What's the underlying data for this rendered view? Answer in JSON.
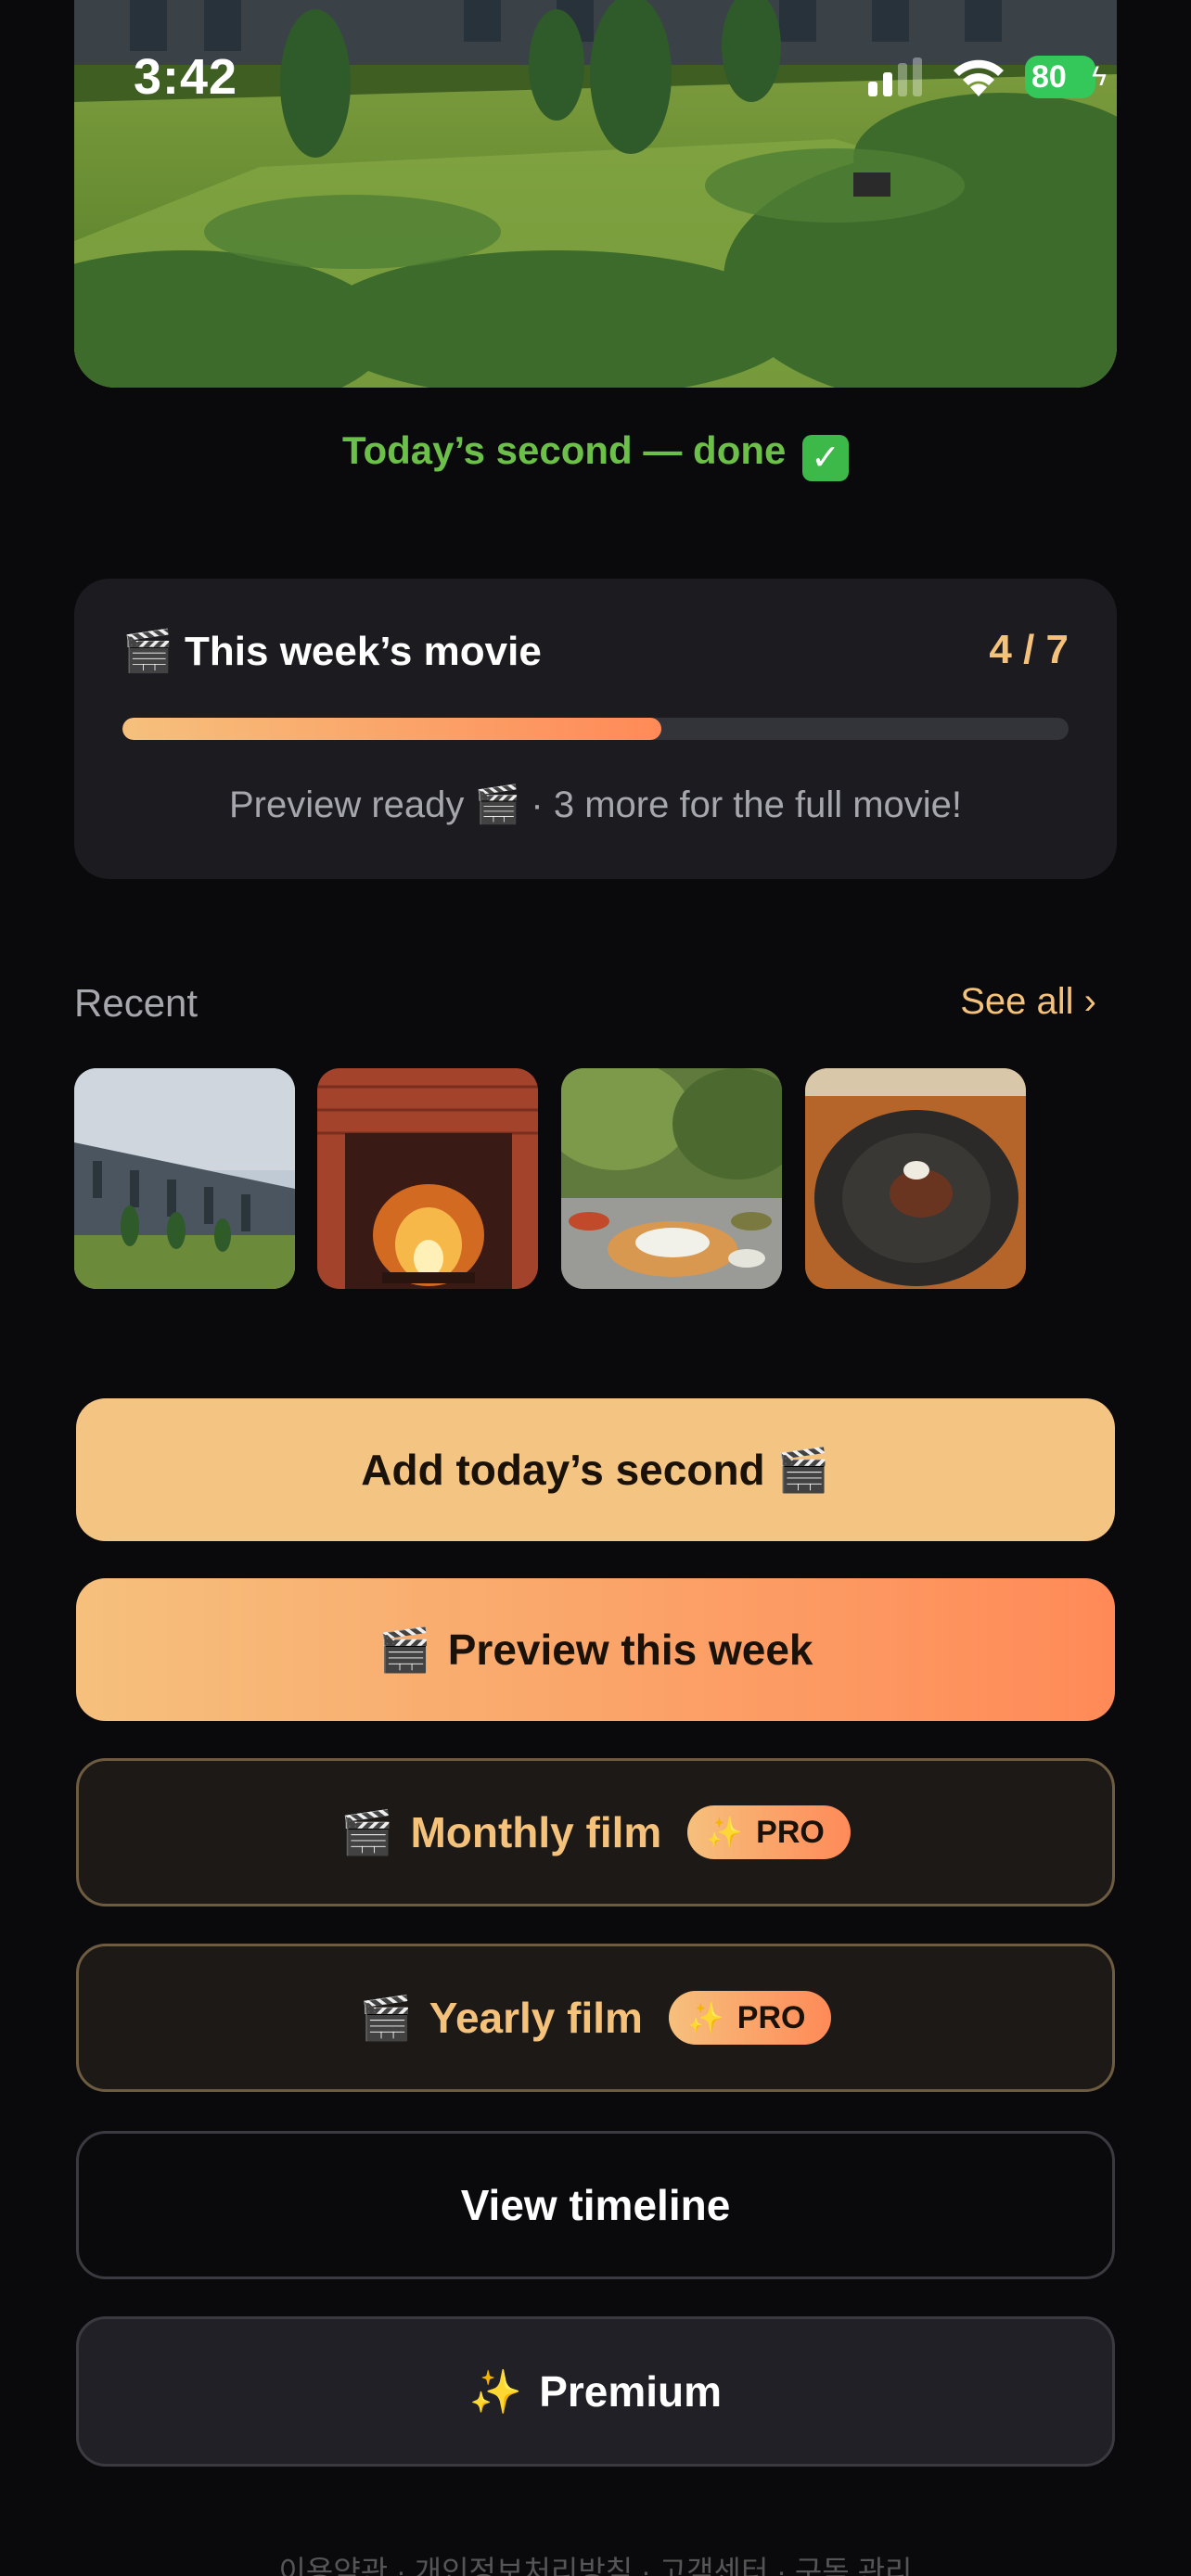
{
  "status_bar": {
    "time": "3:42",
    "battery": "80"
  },
  "today": {
    "done_text": "Today’s second — done",
    "check_glyph": "✓"
  },
  "week_card": {
    "icon": "🎬",
    "title": "This week’s movie",
    "count": "4 / 7",
    "progress": 0.57,
    "note": "Preview ready 🎬 · 3 more for the full movie!"
  },
  "recent": {
    "label": "Recent",
    "see_all": "See all ›",
    "thumbs": [
      "palace-garden-photo",
      "fireplace-photo",
      "korean-meal-photo",
      "dessert-plate-photo"
    ]
  },
  "buttons": {
    "add": "Add today’s second 🎬",
    "preview_icon": "🎬",
    "preview": "Preview this week",
    "monthly_icon": "🎬",
    "monthly": "Monthly film",
    "yearly_icon": "🎬",
    "yearly": "Yearly film",
    "pro_spark": "✨",
    "pro": "PRO",
    "timeline": "View timeline",
    "premium_spark": "✨",
    "premium": "Premium"
  },
  "footer": "이용약관 · 개인정보처리방침 · 고객센터 · 구독 관리",
  "colors": {
    "background": "#0a0a0d",
    "accent_gold": "#f4c27a",
    "accent_orange": "#ff8a58",
    "success_green": "#6cc04a",
    "card": "#1b1b20"
  }
}
